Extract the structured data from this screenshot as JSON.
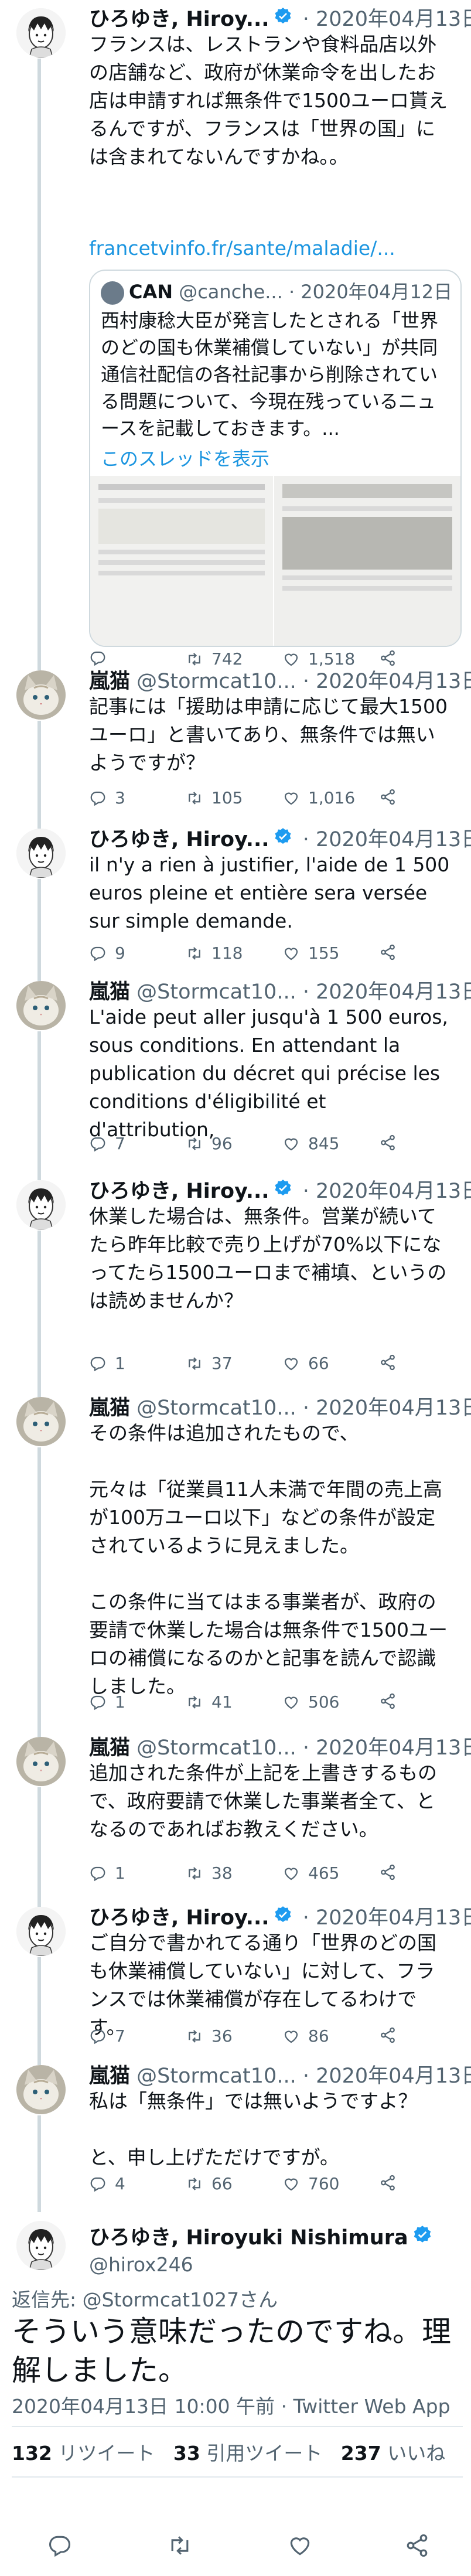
{
  "tweets": [
    {
      "user": "hiro",
      "name": "ひろゆき, Hiroy...",
      "handle": "",
      "date": "· 2020年04月13日",
      "text": "フランスは、レストランや食料品店以外の店舗など、政府が休業命令を出したお店は申請すれば無条件で1500ユーロ貰えるんですが、フランスは「世界の国」には含まれてないんですかね。。",
      "link": "francetvinfo.fr/sante/maladie/...",
      "reply": "",
      "retweet": "742",
      "like": "1,518"
    },
    {
      "user": "cat",
      "name": "嵐猫",
      "handle": "@Stormcat10...",
      "date": "· 2020年04月13日",
      "text": "記事には「援助は申請に応じて最大1500ユーロ」と書いてあり、無条件では無いようですが？",
      "reply": "3",
      "retweet": "105",
      "like": "1,016"
    },
    {
      "user": "hiro",
      "name": "ひろゆき, Hiroy...",
      "handle": "",
      "date": "· 2020年04月13日",
      "text": "il n'y a rien à justifier, l'aide de 1 500 euros pleine et entière sera versée sur simple demande.",
      "reply": "9",
      "retweet": "118",
      "like": "155"
    },
    {
      "user": "cat",
      "name": "嵐猫",
      "handle": "@Stormcat10...",
      "date": "· 2020年04月13日",
      "text": "L'aide peut aller jusqu'à 1 500 euros, sous conditions. En attendant la publication du décret qui précise les conditions d'éligibilité et d'attribution,",
      "reply": "7",
      "retweet": "96",
      "like": "845"
    },
    {
      "user": "hiro",
      "name": "ひろゆき, Hiroy...",
      "handle": "",
      "date": "· 2020年04月13日",
      "text": "休業した場合は、無条件。営業が続いてたら昨年比較で売り上げが70%以下になってたら1500ユーロまで補填、というのは読めませんか？",
      "reply": "1",
      "retweet": "37",
      "like": "66"
    },
    {
      "user": "cat",
      "name": "嵐猫",
      "handle": "@Stormcat10...",
      "date": "· 2020年04月13日",
      "text": "その条件は追加されたもので、\n\n元々は「従業員11人未満で年間の売上高が100万ユーロ以下」などの条件が設定されているように見えました。\n\nこの条件に当てはまる事業者が、政府の要請で休業した場合は無条件で1500ユーロの補償になるのかと記事を読んで認識しました。",
      "reply": "1",
      "retweet": "41",
      "like": "506"
    },
    {
      "user": "cat",
      "name": "嵐猫",
      "handle": "@Stormcat10...",
      "date": "· 2020年04月13日",
      "text": "追加された条件が上記を上書きするもので、政府要請で休業した事業者全て、となるのであればお教えください。",
      "reply": "1",
      "retweet": "38",
      "like": "465"
    },
    {
      "user": "hiro",
      "name": "ひろゆき, Hiroy...",
      "handle": "",
      "date": "· 2020年04月13日",
      "text": "ご自分で書かれてる通り「世界のどの国も休業補償していない」に対して、フランスでは休業補償が存在してるわけです。",
      "reply": "7",
      "retweet": "36",
      "like": "86"
    },
    {
      "user": "cat",
      "name": "嵐猫",
      "handle": "@Stormcat10...",
      "date": "· 2020年04月13日",
      "text": "私は「無条件」では無いようですよ？\n\nと、申し上げただけですが。",
      "reply": "4",
      "retweet": "66",
      "like": "760"
    }
  ],
  "quote": {
    "name": "CAN",
    "handle": "@canche...",
    "date": "· 2020年04月12日",
    "text": "西村康稔大臣が発言したとされる「世界のどの国も休業補償していない」が共同通信社配信の各社記事から削除されている問題について、今現在残っているニュースを記載しておきます。...",
    "more": "このスレッドを表示"
  },
  "focus": {
    "name": "ひろゆき, Hiroyuki Nishimura",
    "handle": "@hirox246",
    "reply_to": "返信先: @Stormcat1027さん",
    "text": "そういう意味だったのですね。理解しました。",
    "meta": "2020年04月13日 10:00 午前 · Twitter Web App",
    "retweets": "132",
    "retweets_label": "リツイート",
    "quotes": "33",
    "quotes_label": "引用ツイート",
    "likes": "237",
    "likes_label": "いいね"
  },
  "colors": {
    "accent": "#1b95e0",
    "muted": "#536471",
    "verified": "#1d9bf0"
  }
}
